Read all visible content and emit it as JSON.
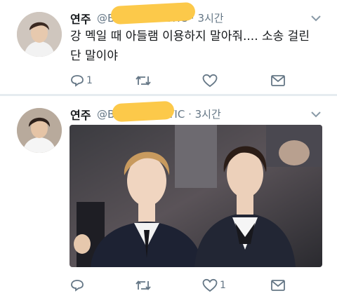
{
  "tweets": [
    {
      "name": "연주",
      "handle": "@BEEFNERGETIC · 3시간",
      "text": "강 멕일 때 아들램 이용하지 말아줘.... 소송 걸린 단 말이야",
      "counts": {
        "reply": "1",
        "retweet": "",
        "like": ""
      }
    },
    {
      "name": "연주",
      "handle": "@BE  ENERGETIC · 3시간",
      "text": "",
      "counts": {
        "reply": "",
        "retweet": "",
        "like": "1"
      }
    }
  ],
  "colors": {
    "censor": "#fcc94a",
    "muted": "#657786",
    "divider": "#e6ecf0"
  },
  "icons": [
    "chevron-down-icon",
    "reply-icon",
    "retweet-icon",
    "like-icon",
    "message-icon"
  ]
}
